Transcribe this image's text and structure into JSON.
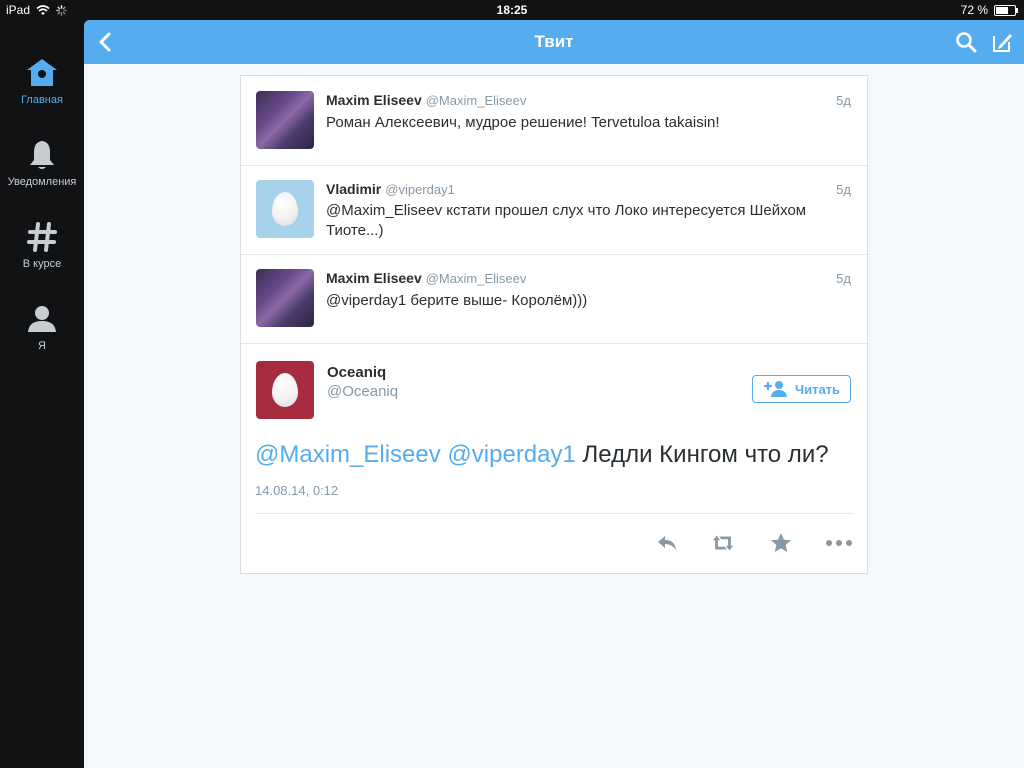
{
  "status_bar": {
    "device": "iPad",
    "time": "18:25",
    "battery": "72 %",
    "battery_level": 0.72
  },
  "sidebar": {
    "items": [
      {
        "label": "Главная",
        "icon": "home-icon",
        "active": true
      },
      {
        "label": "Уведомления",
        "icon": "bell-icon",
        "active": false
      },
      {
        "label": "В курсе",
        "icon": "hashtag-icon",
        "active": false
      },
      {
        "label": "Я",
        "icon": "profile-icon",
        "active": false
      }
    ]
  },
  "header": {
    "title": "Твит",
    "back_icon": "chevron-left-icon",
    "search_icon": "search-icon",
    "compose_icon": "compose-icon"
  },
  "colors": {
    "accent": "#55acee",
    "sidebar_bg": "#111214",
    "panel_bg": "#f5f8fa",
    "egg_blue": "#a7d3ea",
    "egg_red": "#a62b3e"
  },
  "tweets": [
    {
      "name": "Maxim Eliseev",
      "handle": "@Maxim_Eliseev",
      "time": "5д",
      "text": "Роман Алексеевич, мудрое решение! Tervetuloa takaisin!"
    },
    {
      "name": "Vladimir",
      "handle": "@viperday1",
      "time": "5д",
      "text": "@Maxim_Eliseev кстати прошел слух что Локо интересуется Шейхом Тиоте...)"
    },
    {
      "name": "Maxim Eliseev",
      "handle": "@Maxim_Eliseev",
      "time": "5д",
      "text": "@viperday1 берите выше- Королём)))"
    }
  ],
  "focus_tweet": {
    "name": "Oceaniq",
    "handle": "@Oceaniq",
    "follow_label": "Читать",
    "mention_1": "@Maxim_Eliseev",
    "mention_2": "@viperday1",
    "body": "Ледли Кингом что ли?",
    "date": "14.08.14, 0:12",
    "actions": [
      "reply-icon",
      "retweet-icon",
      "favorite-icon",
      "more-icon"
    ]
  }
}
